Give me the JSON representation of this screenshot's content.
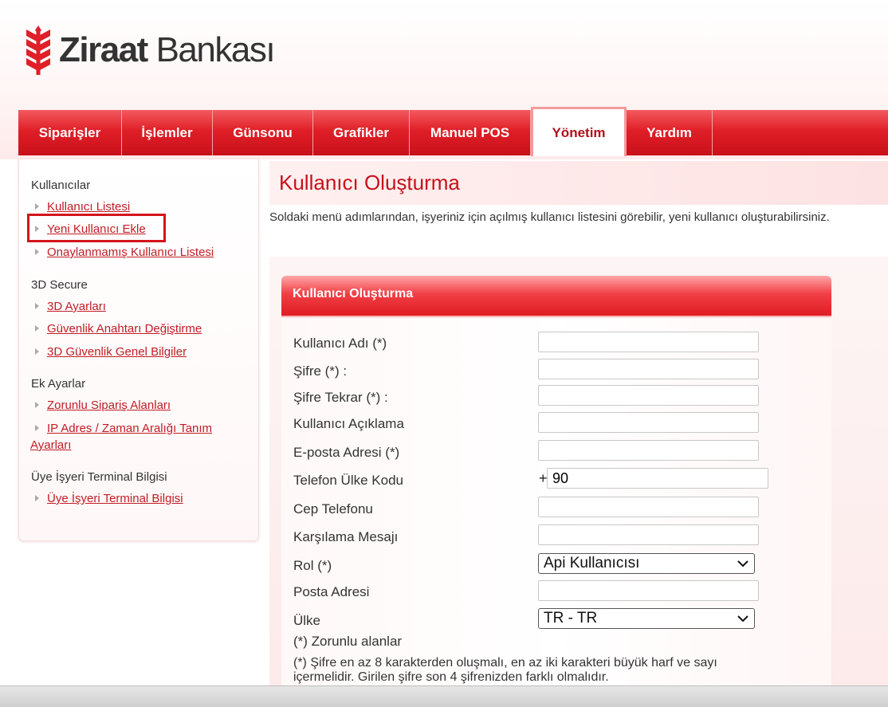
{
  "brand": {
    "name_bold": "Ziraat",
    "name_regular": "Bankası",
    "primary_color": "#e01f27"
  },
  "nav": {
    "items": [
      {
        "label": "Siparişler"
      },
      {
        "label": "İşlemler"
      },
      {
        "label": "Günsonu"
      },
      {
        "label": "Grafikler"
      },
      {
        "label": "Manuel POS"
      },
      {
        "label": "Yönetim",
        "active": true
      },
      {
        "label": "Yardım"
      }
    ]
  },
  "sidebar": {
    "groups": [
      {
        "title": "Kullanıcılar",
        "links": [
          "Kullanıcı Listesi",
          "Yeni Kullanıcı Ekle",
          "Onaylanmamış Kullanıcı Listesi"
        ]
      },
      {
        "title": "3D Secure",
        "links": [
          "3D Ayarları",
          "Güvenlik Anahtarı Değiştirme",
          "3D Güvenlik Genel Bilgiler"
        ]
      },
      {
        "title": "Ek Ayarlar",
        "links": [
          "Zorunlu Sipariş Alanları",
          "IP Adres / Zaman Aralığı Tanım",
          "Ayarları"
        ]
      },
      {
        "title": "Üye İşyeri Terminal Bilgisi",
        "links": [
          "Üye İşyeri Terminal Bilgisi"
        ]
      }
    ],
    "highlighted_link": "Yeni Kullanıcı Ekle"
  },
  "page": {
    "title": "Kullanıcı Oluşturma",
    "description": "Soldaki menü adımlarından, işyeriniz için açılmış kullanıcı listesini görebilir, yeni kullanıcı oluşturabilirsiniz."
  },
  "form": {
    "header": "Kullanıcı Oluşturma",
    "labels": {
      "username": "Kullanıcı Adı (*)",
      "password": "Şifre (*) :",
      "password_repeat": "Şifre Tekrar (*) :",
      "description": "Kullanıcı Açıklama",
      "email": "E-posta Adresi (*)",
      "country_code": "Telefon Ülke Kodu",
      "mobile": "Cep Telefonu",
      "welcome": "Karşılama Mesajı",
      "role": "Rol (*)",
      "postal": "Posta Adresi",
      "country": "Ülke"
    },
    "values": {
      "username": "",
      "password": "",
      "password_repeat": "",
      "description": "",
      "email": "",
      "country_code_prefix": "+",
      "country_code": "90",
      "mobile": "",
      "welcome": "",
      "role": "Api Kullanıcısı",
      "postal": "",
      "country": "TR - TR"
    },
    "notes": {
      "required": "(*) Zorunlu alanlar",
      "password_rule_line1": "(*) Şifre en az 8 karakterden oluşmalı, en az iki karakteri büyük harf ve sayı",
      "password_rule_line2": "içermelidir. Girilen şifre son 4 şifrenizden farklı olmalıdır."
    }
  }
}
